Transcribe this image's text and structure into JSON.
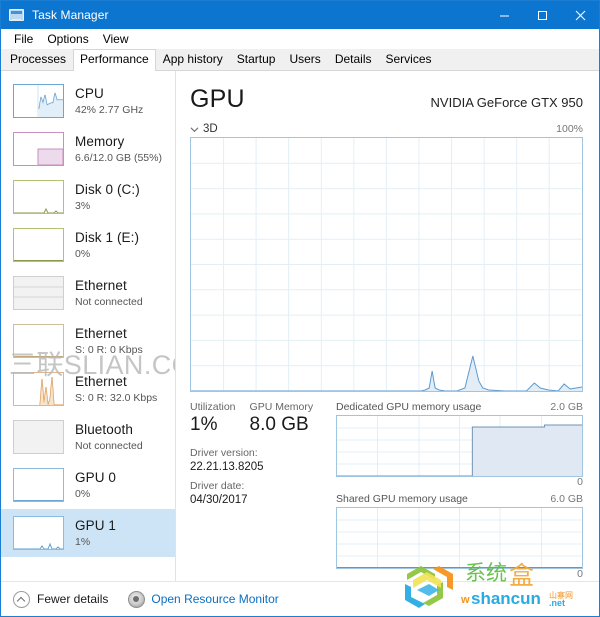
{
  "window": {
    "title": "Task Manager",
    "icon": "task-manager-icon",
    "controls": {
      "minimize": "–",
      "maximize": "□",
      "close": "✕"
    }
  },
  "menu": {
    "items": [
      "File",
      "Options",
      "View"
    ]
  },
  "tabs": {
    "items": [
      "Processes",
      "Performance",
      "App history",
      "Startup",
      "Users",
      "Details",
      "Services"
    ],
    "active": "Performance"
  },
  "sidebar": {
    "items": [
      {
        "name": "CPU",
        "sub": "42%  2.77 GHz",
        "selected": false,
        "accent": "#6ba7d6",
        "graph": "cpu"
      },
      {
        "name": "Memory",
        "sub": "6.6/12.0 GB (55%)",
        "selected": false,
        "accent": "#c98fc0",
        "graph": "memory"
      },
      {
        "name": "Disk 0 (C:)",
        "sub": "3%",
        "selected": false,
        "accent": "#a9b86a",
        "graph": "disk0"
      },
      {
        "name": "Disk 1 (E:)",
        "sub": "0%",
        "selected": false,
        "accent": "#a9b86a",
        "graph": "disk1"
      },
      {
        "name": "Ethernet",
        "sub": "Not connected",
        "selected": false,
        "accent": "#bdbdbd",
        "graph": "eth-none"
      },
      {
        "name": "Ethernet",
        "sub": "S: 0  R: 0 Kbps",
        "selected": false,
        "accent": "#c3b48f",
        "graph": "eth-idle"
      },
      {
        "name": "Ethernet",
        "sub": "S: 0  R: 32.0 Kbps",
        "selected": false,
        "accent": "#d79b63",
        "graph": "eth-busy"
      },
      {
        "name": "Bluetooth",
        "sub": "Not connected",
        "selected": false,
        "accent": "#bdbdbd",
        "graph": "bt-none"
      },
      {
        "name": "GPU 0",
        "sub": "0%",
        "selected": false,
        "accent": "#6ba7d6",
        "graph": "gpu0"
      },
      {
        "name": "GPU 1",
        "sub": "1%",
        "selected": true,
        "accent": "#6ba7d6",
        "graph": "gpu1"
      }
    ]
  },
  "main": {
    "title": "GPU",
    "model": "NVIDIA GeForce GTX 950",
    "engine_label": "3D",
    "engine_chevron": "chevron-down-icon",
    "chart_max_label": "100%",
    "stats": [
      {
        "label": "Utilization",
        "value": "1%"
      },
      {
        "label": "GPU Memory",
        "value": "8.0 GB"
      }
    ],
    "driver": [
      {
        "label": "Driver version:",
        "value": "22.21.13.8205"
      },
      {
        "label": "Driver date:",
        "value": "04/30/2017"
      }
    ],
    "mem_charts": [
      {
        "title": "Dedicated GPU memory usage",
        "max": "2.0 GB",
        "min": "0"
      },
      {
        "title": "Shared GPU memory usage",
        "max": "6.0 GB",
        "min": "0"
      }
    ]
  },
  "footer": {
    "fewer_details": "Fewer details",
    "resource_monitor": "Open Resource Monitor"
  },
  "watermark": {
    "text": "三联SLIAN.COM",
    "logo_cn": "系统盒",
    "logo_en": "wshancun",
    "logo_tld": ".net"
  },
  "chart_data": [
    {
      "type": "area",
      "name": "3d-utilization",
      "title": "3D",
      "ylabel": "%",
      "ylim": [
        0,
        100
      ],
      "max_label": "100%",
      "grid": true,
      "x": [
        0,
        4,
        8,
        12,
        16,
        20,
        24,
        28,
        32,
        36,
        40,
        44,
        48,
        52,
        56,
        60,
        62,
        64,
        66,
        68,
        70,
        72,
        74,
        76,
        78,
        80,
        82,
        84,
        86,
        88,
        90,
        92,
        94,
        96,
        98,
        100
      ],
      "values": [
        0,
        0,
        0,
        0,
        0,
        0,
        0,
        0,
        0,
        0,
        0,
        0,
        0,
        0,
        0,
        0,
        0,
        0,
        0,
        0,
        0,
        0,
        0,
        1,
        10,
        2,
        1,
        1,
        22,
        3,
        1,
        1,
        1,
        6,
        2,
        5
      ]
    },
    {
      "type": "area",
      "name": "dedicated-gpu-memory-usage",
      "title": "Dedicated GPU memory usage",
      "ylim": [
        0,
        2.0
      ],
      "max_label": "2.0 GB",
      "min_label": "0",
      "grid": true,
      "x": [
        0,
        20,
        40,
        55,
        56,
        60,
        70,
        80,
        90,
        100
      ],
      "values": [
        0,
        0,
        0,
        0,
        1.62,
        1.62,
        1.62,
        1.62,
        1.66,
        1.66
      ]
    },
    {
      "type": "area",
      "name": "shared-gpu-memory-usage",
      "title": "Shared GPU memory usage",
      "ylim": [
        0,
        6.0
      ],
      "max_label": "6.0 GB",
      "min_label": "0",
      "grid": true,
      "x": [
        0,
        25,
        50,
        75,
        100
      ],
      "values": [
        0,
        0,
        0,
        0,
        0
      ]
    }
  ]
}
